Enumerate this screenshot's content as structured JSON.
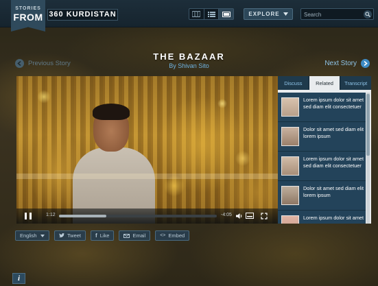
{
  "header": {
    "logo_small": "STORIES",
    "logo_big": "FROM",
    "site_title": "360 KURDISTAN",
    "view_modes": [
      "map-view",
      "list-view",
      "grid-view"
    ],
    "explore_label": "EXPLORE",
    "search_placeholder": "Search"
  },
  "story": {
    "title": "THE BAZAAR",
    "author": "By Shivan Sito",
    "prev_label": "Previous Story",
    "next_label": "Next Story"
  },
  "player": {
    "current_time": "1:12",
    "remaining_time": "-4:05",
    "progress": 0.3
  },
  "panel": {
    "tabs": [
      {
        "label": "Discuss",
        "active": false
      },
      {
        "label": "Related",
        "active": true
      },
      {
        "label": "Transcript",
        "active": false
      }
    ],
    "items": [
      {
        "text": "Lorem ipsum dolor sit amet sed diam elit consectetuer",
        "thumb_color": "#b8a08a"
      },
      {
        "text": "Dolor sit amet sed diam elit lorem ipsum",
        "thumb_color": "#9a7f6a"
      },
      {
        "text": "Lorem ipsum dolor sit amet sed diam elit consectetuer",
        "thumb_color": "#a88e78"
      },
      {
        "text": "Dolor sit amet sed diam elit lorem ipsum",
        "thumb_color": "#8d7764"
      },
      {
        "text": "Lorem ipsum dolor sit amet",
        "thumb_color": "#c49a88"
      }
    ]
  },
  "share": {
    "language": "English",
    "tweet": "Tweet",
    "like": "Like",
    "email": "Email",
    "embed": "Embed"
  },
  "info_label": "i",
  "colors": {
    "accent": "#3e8bc4",
    "topbar": "#1d2e3a",
    "panel_list": "#23435a"
  }
}
